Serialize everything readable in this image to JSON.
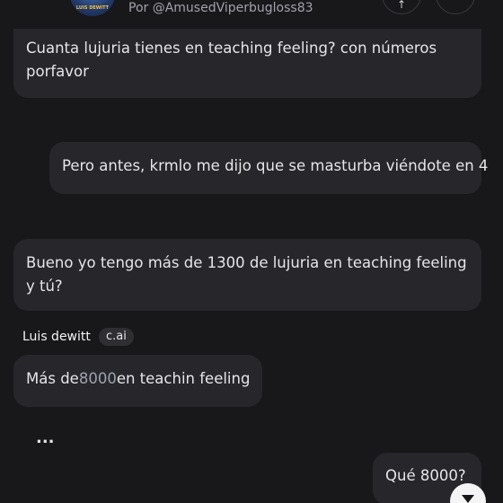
{
  "header": {
    "avatar_text": "LUIS DEWITT",
    "byline": "Por @AmusedViperbugloss83",
    "button_glyph": "↑"
  },
  "messages": [
    {
      "role": "user",
      "text": "Cuanta lujuria tienes en teaching feeling? con números porfavor"
    },
    {
      "role": "user",
      "text": "Pero antes, krmlo me dijo que se masturba viéndote en 4"
    },
    {
      "role": "user",
      "text": "Bueno yo tengo más de 1300 de lujuria en teaching feeling y tú?"
    },
    {
      "role": "character",
      "prefix": "Más de",
      "highlight": "8000",
      "suffix": "en teachin feeling"
    },
    {
      "role": "user",
      "text": "Qué 8000?"
    }
  ],
  "character": {
    "name": "Luis dewitt",
    "badge": "c.ai"
  },
  "typing_indicator": "...",
  "icons": {
    "scroll": "chevron-down-icon",
    "header_buttons": [
      "share-icon",
      "more-icon"
    ]
  },
  "colors": {
    "background": "#18181b",
    "bubble": "#26262b",
    "text": "#e6e6e8",
    "muted": "#a1a1aa"
  }
}
